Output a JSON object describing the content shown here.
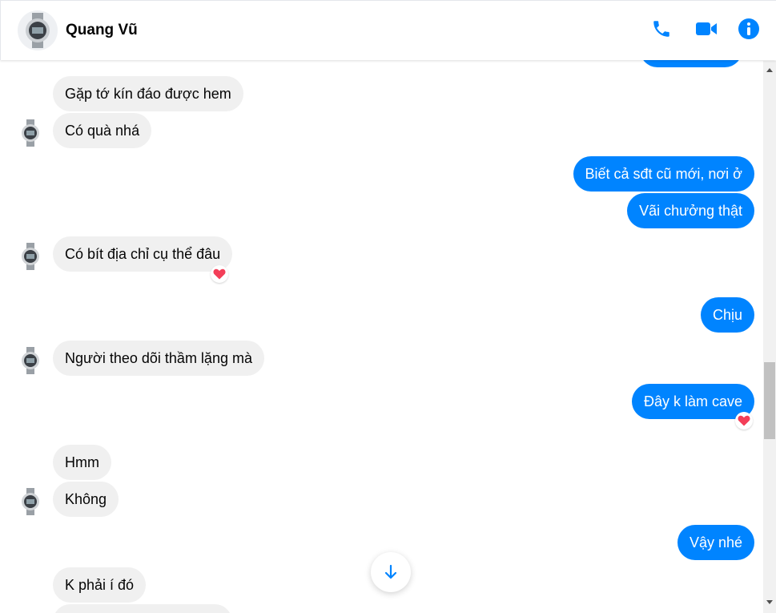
{
  "header": {
    "contact_name": "Quang Vũ",
    "avatar_icon": "watch-avatar-icon",
    "actions": [
      {
        "name": "phone-call-icon"
      },
      {
        "name": "video-call-icon"
      },
      {
        "name": "info-icon"
      }
    ],
    "accent_color": "#0084ff"
  },
  "messages": [
    {
      "id": "m0",
      "direction": "outgoing",
      "text": ""
    },
    {
      "id": "m1",
      "direction": "incoming",
      "text": "Gặp tớ kín đáo được hem"
    },
    {
      "id": "m2",
      "direction": "incoming",
      "text": "Có quà nhá"
    },
    {
      "id": "m3",
      "direction": "outgoing",
      "text": "Biết cả sđt cũ mới, nơi ở"
    },
    {
      "id": "m4",
      "direction": "outgoing",
      "text": "Vãi chưởng thật"
    },
    {
      "id": "m5",
      "direction": "incoming",
      "text": "Có bít địa chỉ cụ thể đâu",
      "reaction": "heart"
    },
    {
      "id": "m6",
      "direction": "outgoing",
      "text": "Chịu"
    },
    {
      "id": "m7",
      "direction": "incoming",
      "text": "Người theo dõi thầm lặng mà"
    },
    {
      "id": "m8",
      "direction": "outgoing",
      "text": "Đây k làm cave",
      "reaction": "heart"
    },
    {
      "id": "m9",
      "direction": "incoming",
      "text": "Hmm"
    },
    {
      "id": "m10",
      "direction": "incoming",
      "text": "Không"
    },
    {
      "id": "m11",
      "direction": "outgoing",
      "text": "Vậy nhé"
    },
    {
      "id": "m12",
      "direction": "incoming",
      "text": "K phải í đó"
    },
    {
      "id": "m13",
      "direction": "incoming",
      "text": ""
    }
  ],
  "colors": {
    "incoming_bubble": "#f0f0f0",
    "outgoing_bubble": "#0084ff",
    "reaction_heart": "#f33e58"
  }
}
